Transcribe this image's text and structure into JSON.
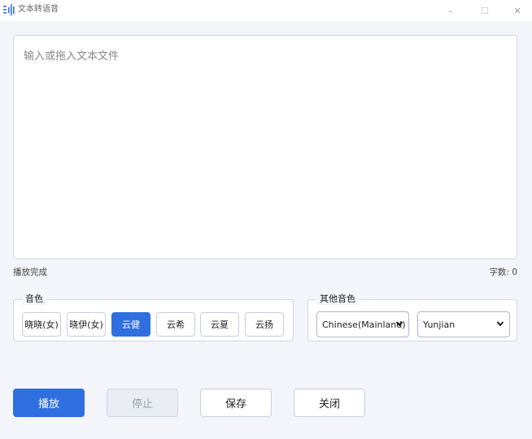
{
  "window": {
    "title": "文本转语音",
    "minimize_glyph": "–",
    "maximize_glyph": "☐",
    "close_glyph": "✕"
  },
  "editor": {
    "placeholder": "输入或拖入文本文件",
    "value": ""
  },
  "status": {
    "text": "播放完成",
    "count_label": "字数: 0"
  },
  "voice_group": {
    "legend": "音色",
    "buttons": [
      {
        "label": "晓晓(女)",
        "active": false
      },
      {
        "label": "晓伊(女)",
        "active": false
      },
      {
        "label": "云健",
        "active": true
      },
      {
        "label": "云希",
        "active": false
      },
      {
        "label": "云夏",
        "active": false
      },
      {
        "label": "云扬",
        "active": false
      }
    ]
  },
  "other_group": {
    "legend": "其他音色",
    "language_selected": "Chinese(Mainland)",
    "voice_selected": "Yunjian"
  },
  "actions": {
    "play": "播放",
    "stop": "停止",
    "save": "保存",
    "close": "关闭"
  },
  "colors": {
    "accent": "#2f6fe0",
    "background": "#f3f5fa",
    "disabled": "#e9ecf3"
  }
}
